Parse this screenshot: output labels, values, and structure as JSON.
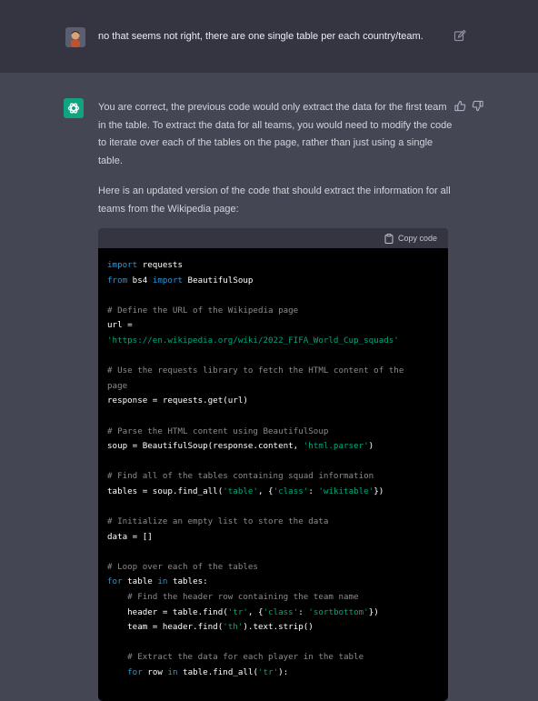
{
  "user_message": {
    "text": "no that seems not right, there are one single table per each country/team.",
    "edit_icon": "pencil-square-icon"
  },
  "assistant_message": {
    "paragraphs": [
      "You are correct, the previous code would only extract the data for the first team in the table. To extract the data for all teams, you would need to modify the code to iterate over each of the tables on the page, rather than just using a single table.",
      "Here is an updated version of the code that should extract the information for all teams from the Wikipedia page:"
    ],
    "feedback_icons": [
      "thumbs-up-icon",
      "thumbs-down-icon"
    ]
  },
  "code_block": {
    "copy_label": "Copy code",
    "lines": [
      [
        [
          "kw",
          "import"
        ],
        [
          "t",
          " requests"
        ]
      ],
      [
        [
          "kw",
          "from"
        ],
        [
          "t",
          " bs4 "
        ],
        [
          "kw",
          "import"
        ],
        [
          "t",
          " BeautifulSoup"
        ]
      ],
      [],
      [
        [
          "cm",
          "# Define the URL of the Wikipedia page"
        ]
      ],
      [
        [
          "t",
          "url = "
        ]
      ],
      [
        [
          "st",
          "'https://en.wikipedia.org/wiki/2022_FIFA_World_Cup_squads'"
        ]
      ],
      [],
      [
        [
          "cm",
          "# Use the requests library to fetch the HTML content of the"
        ]
      ],
      [
        [
          "cm",
          "page"
        ]
      ],
      [
        [
          "t",
          "response = requests.get(url)"
        ]
      ],
      [],
      [
        [
          "cm",
          "# Parse the HTML content using BeautifulSoup"
        ]
      ],
      [
        [
          "t",
          "soup = BeautifulSoup(response.content, "
        ],
        [
          "st",
          "'html.parser'"
        ],
        [
          "t",
          ")"
        ]
      ],
      [],
      [
        [
          "cm",
          "# Find all of the tables containing squad information"
        ]
      ],
      [
        [
          "t",
          "tables = soup.find_all("
        ],
        [
          "st",
          "'table'"
        ],
        [
          "t",
          ", {"
        ],
        [
          "st",
          "'class'"
        ],
        [
          "t",
          ": "
        ],
        [
          "st",
          "'wikitable'"
        ],
        [
          "t",
          "})"
        ]
      ],
      [],
      [
        [
          "cm",
          "# Initialize an empty list to store the data"
        ]
      ],
      [
        [
          "t",
          "data = []"
        ]
      ],
      [],
      [
        [
          "cm",
          "# Loop over each of the tables"
        ]
      ],
      [
        [
          "kw",
          "for"
        ],
        [
          "t",
          " table "
        ],
        [
          "kw",
          "in"
        ],
        [
          "t",
          " tables:"
        ]
      ],
      [
        [
          "t",
          "    "
        ],
        [
          "cm",
          "# Find the header row containing the team name"
        ]
      ],
      [
        [
          "t",
          "    header = table.find("
        ],
        [
          "st",
          "'tr'"
        ],
        [
          "t",
          ", {"
        ],
        [
          "st",
          "'class'"
        ],
        [
          "t",
          ": "
        ],
        [
          "st",
          "'sortbottom'"
        ],
        [
          "t",
          "})"
        ]
      ],
      [
        [
          "t",
          "    team = header.find("
        ],
        [
          "st",
          "'th'"
        ],
        [
          "t",
          ").text.strip()"
        ]
      ],
      [],
      [
        [
          "t",
          "    "
        ],
        [
          "cm",
          "# Extract the data for each player in the table"
        ]
      ],
      [
        [
          "t",
          "    "
        ],
        [
          "kw",
          "for"
        ],
        [
          "t",
          " row "
        ],
        [
          "kw",
          "in"
        ],
        [
          "t",
          " table.find_all("
        ],
        [
          "st",
          "'tr'"
        ],
        [
          "t",
          "):"
        ]
      ]
    ]
  }
}
